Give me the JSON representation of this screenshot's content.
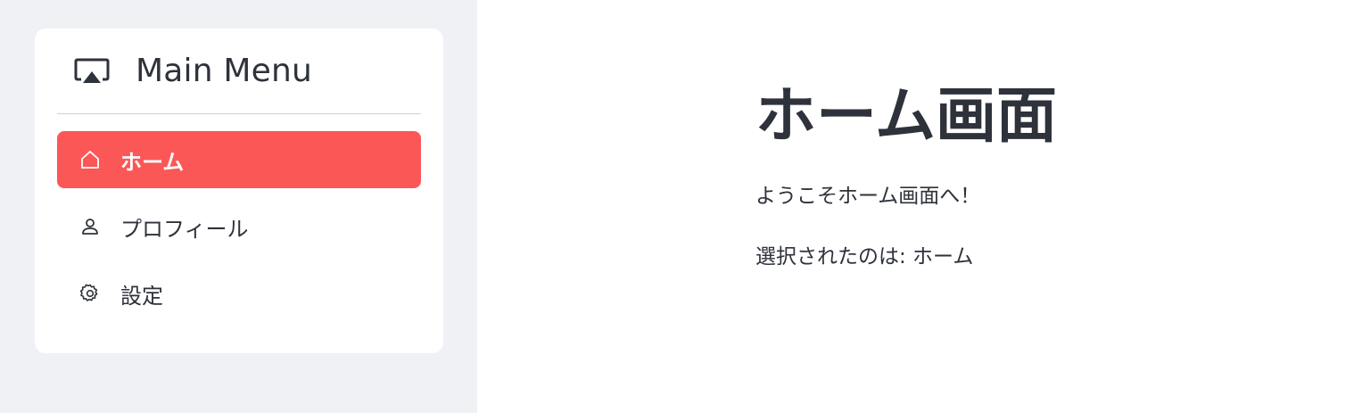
{
  "sidebar": {
    "header": {
      "title": "Main Menu",
      "icon": "airplay-icon"
    },
    "items": [
      {
        "label": "ホーム",
        "icon": "home-icon",
        "active": true
      },
      {
        "label": "プロフィール",
        "icon": "user-icon",
        "active": false
      },
      {
        "label": "設定",
        "icon": "gear-icon",
        "active": false
      }
    ]
  },
  "main": {
    "title": "ホーム画面",
    "welcome": "ようこそホーム画面へ！",
    "selected_text": "選択されたのは: ホーム"
  },
  "colors": {
    "sidebar_bg": "#f0f1f5",
    "accent": "#fb5757",
    "text": "#2e323b"
  }
}
